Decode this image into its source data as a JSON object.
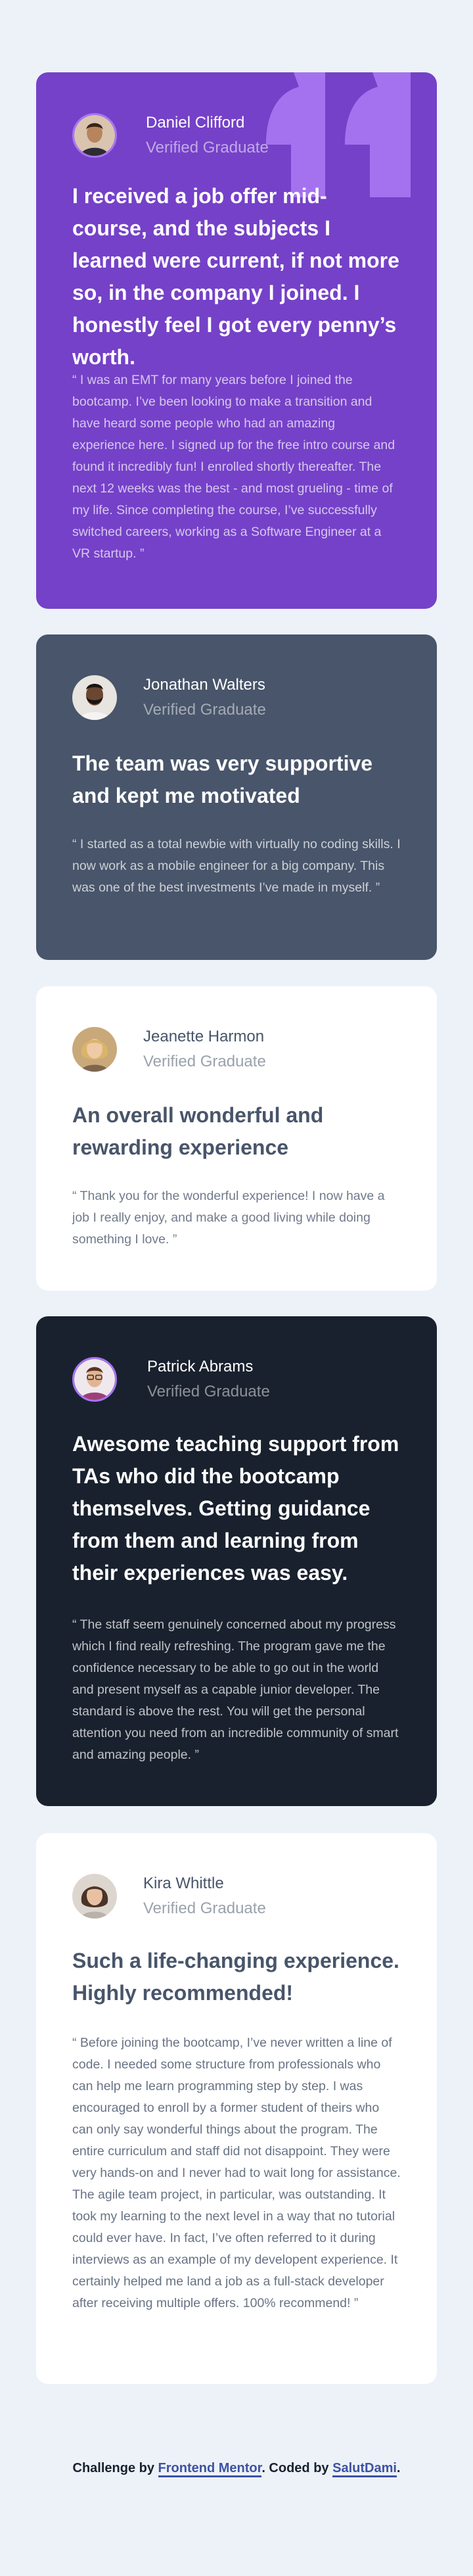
{
  "testimonials": [
    {
      "name": "Daniel Clifford",
      "role": "Verified Graduate",
      "headline": "I received a job offer mid-course, and the subjects I learned were current, if not more so, in the company I joined. I honestly feel I got every penny’s worth.",
      "quote": "“ I was an EMT for many years before I joined the bootcamp. I’ve been looking to make a transition and have heard some people who had an amazing experience here. I signed up for the free intro course and found it incredibly fun! I enrolled shortly thereafter. The next 12 weeks was the best - and most grueling - time of my life. Since completing the course, I’ve successfully switched careers, working as a Software Engineer at a VR startup. ”",
      "avatar_icon": "portrait-man-short-hair",
      "accent": "#7541c8"
    },
    {
      "name": "Jonathan Walters",
      "role": "Verified Graduate",
      "headline": "The team was very supportive and kept me motivated",
      "quote": "“ I started as a total newbie with virtually no coding skills. I now work as a mobile engineer for a big company. This was one of the best investments I’ve made in myself. ”",
      "avatar_icon": "portrait-man-beard",
      "accent": "#48556a"
    },
    {
      "name": "Jeanette Harmon",
      "role": "Verified Graduate",
      "headline": "An overall wonderful and rewarding experience",
      "quote": "“ Thank you for the wonderful experience! I now have a job I really enjoy, and make a good living while doing something I love. ”",
      "avatar_icon": "portrait-woman-blonde",
      "accent": "#ffffff"
    },
    {
      "name": "Patrick Abrams",
      "role": "Verified Graduate",
      "headline": "Awesome teaching support from TAs who did the bootcamp themselves. Getting guidance from them and learning from their experiences was easy.",
      "quote": "“ The staff seem genuinely concerned about my progress which I find really refreshing. The program gave me the confidence necessary to be able to go out in the world and present myself as a capable junior developer. The standard is above the rest. You will get the personal attention you need from an incredible community of smart and amazing people. ”",
      "avatar_icon": "portrait-man-glasses",
      "accent": "#19212e"
    },
    {
      "name": "Kira Whittle",
      "role": "Verified Graduate",
      "headline": "Such a life-changing experience. Highly recommended!",
      "quote": "“ Before joining the bootcamp, I’ve never written a line of code. I needed some structure from professionals who can help me learn programming step by step. I was encouraged to enroll by a former student of theirs who can only say wonderful things about the program. The entire curriculum and staff did not disappoint. They were very hands-on and I never had to wait long for assistance. The agile team project, in particular, was outstanding. It took my learning to the next level in a way that no tutorial could ever have. In fact, I’ve often referred to it during interviews as an example of my developent experience. It certainly helped me land a job as a full-stack developer after receiving multiple offers. 100% recommend! ”",
      "avatar_icon": "portrait-woman-dark-hair",
      "accent": "#ffffff"
    }
  ],
  "decoration": {
    "quote_icon": "quotation-mark-icon",
    "quote_color": "#a775f1"
  },
  "footer": {
    "prefix": "Challenge by ",
    "link1": "Frontend Mentor",
    "middle": ". Coded by ",
    "link2": "SalutDami",
    "suffix": "."
  }
}
